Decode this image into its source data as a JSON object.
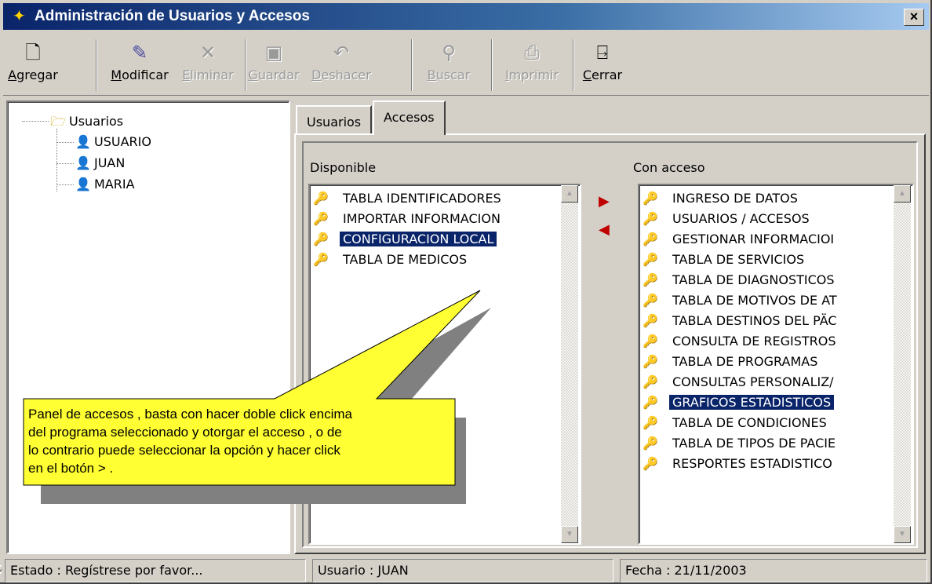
{
  "window": {
    "title": "Administración de Usuarios y Accesos",
    "close_label": "×"
  },
  "toolbar": {
    "agregar": {
      "pre": "",
      "key": "A",
      "rest": "gregar"
    },
    "modificar": {
      "pre": "",
      "key": "M",
      "rest": "odificar"
    },
    "eliminar": {
      "pre": "",
      "key": "E",
      "rest": "liminar"
    },
    "guardar": {
      "pre": "",
      "key": "G",
      "rest": "uardar"
    },
    "deshacer": {
      "pre": "",
      "key": "D",
      "rest": "eshacer"
    },
    "buscar": {
      "pre": "",
      "key": "B",
      "rest": "uscar"
    },
    "imprimir": {
      "pre": "",
      "key": "I",
      "rest": "mprimir"
    },
    "cerrar": {
      "pre": "",
      "key": "C",
      "rest": "errar"
    }
  },
  "tree": {
    "root": "Usuarios",
    "users": [
      "USUARIO",
      "JUAN",
      "MARIA"
    ]
  },
  "tabs": {
    "usuarios": "Usuarios",
    "accesos": "Accesos"
  },
  "accesos": {
    "disponible_label": "Disponible",
    "con_acceso_label": "Con acceso",
    "disponible": [
      "TABLA IDENTIFICADORES",
      "IMPORTAR INFORMACION",
      "CONFIGURACION LOCAL",
      "TABLA DE MEDICOS"
    ],
    "disponible_selected": "CONFIGURACION LOCAL",
    "con_acceso": [
      "INGRESO DE DATOS",
      "USUARIOS / ACCESOS",
      "GESTIONAR INFORMACIOI",
      "TABLA DE SERVICIOS",
      "TABLA DE DIAGNOSTICOS",
      "TABLA DE MOTIVOS DE AT",
      "TABLA DESTINOS DEL PÄC",
      "CONSULTA DE REGISTROS",
      "TABLA DE PROGRAMAS",
      "CONSULTAS PERSONALIZ/",
      "GRAFICOS ESTADISTICOS",
      "TABLA DE CONDICIONES",
      "TABLA DE TIPOS DE PACIE",
      "RESPORTES ESTADISTICO"
    ],
    "con_acceso_selected": "GRAFICOS ESTADISTICOS",
    "add_arrow": "▶",
    "remove_arrow": "◀"
  },
  "callout": {
    "lines": [
      "Panel de accesos , basta con hacer doble click encima",
      "del programa seleccionado y otorgar el acceso , o de",
      "lo contrario puede seleccionar la opción y hacer click",
      "en el botón > ."
    ]
  },
  "status": {
    "estado": "Estado   : Regístrese por favor...",
    "usuario": "Usuario  : JUAN",
    "fecha": "Fecha    : 21/11/2003"
  },
  "colors": {
    "selection": "#0a246a",
    "callout_fill": "#ffff33",
    "arrow": "#c00000",
    "title_start": "#0a246a"
  }
}
